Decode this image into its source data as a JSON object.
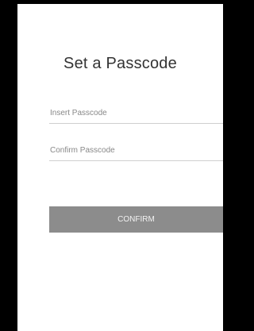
{
  "screen": {
    "title": "Set a Passcode"
  },
  "form": {
    "insert_placeholder": "Insert Passcode",
    "insert_value": "",
    "confirm_placeholder": "Confirm Passcode",
    "confirm_value": "",
    "submit_label": "CONFIRM"
  },
  "colors": {
    "background": "#000000",
    "panel": "#ffffff",
    "button": "#8c8c8c",
    "button_text": "#f2f2f2",
    "divider": "#cfcfcf"
  }
}
